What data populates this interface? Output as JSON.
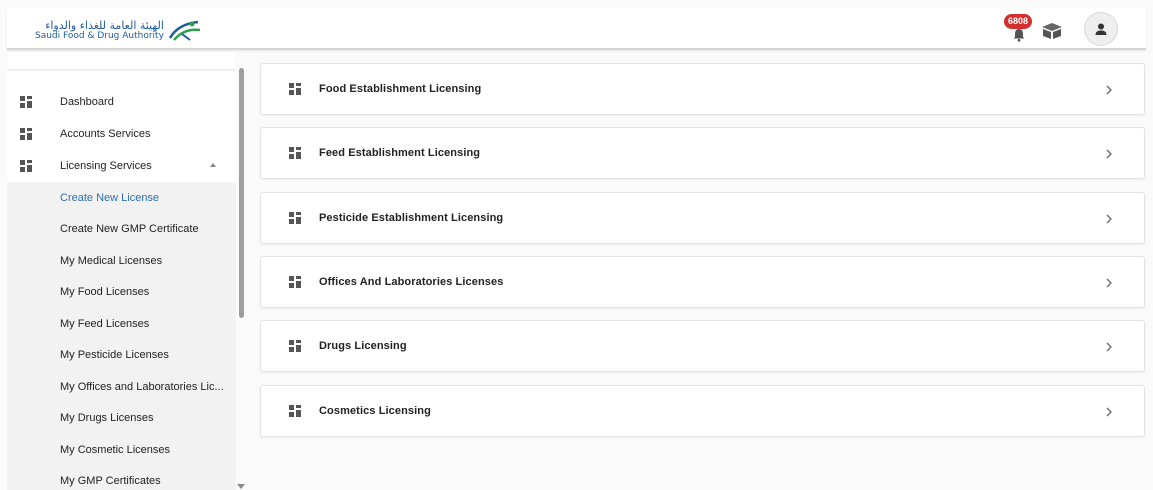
{
  "header": {
    "logo": {
      "arabic": "الهيئة العامة للغذاء والدواء",
      "english": "Saudi Food & Drug Authority"
    },
    "notifications": {
      "count": "6808",
      "icon": "bell-icon"
    },
    "icons": [
      "bell-icon",
      "box-icon",
      "user-icon"
    ]
  },
  "sidebar": {
    "items": [
      {
        "label": "Dashboard",
        "icon": "grid-icon"
      },
      {
        "label": "Accounts Services",
        "icon": "grid-icon"
      },
      {
        "label": "Licensing Services",
        "icon": "grid-icon",
        "expanded": true
      }
    ],
    "sub_items": [
      {
        "label": "Create New License",
        "active": true
      },
      {
        "label": "Create New GMP Certificate"
      },
      {
        "label": "My Medical Licenses"
      },
      {
        "label": "My Food Licenses"
      },
      {
        "label": "My Feed Licenses"
      },
      {
        "label": "My Pesticide Licenses"
      },
      {
        "label": "My Offices and Laboratories Lic..."
      },
      {
        "label": "My Drugs Licenses"
      },
      {
        "label": "My Cosmetic Licenses"
      },
      {
        "label": "My GMP Certificates"
      }
    ]
  },
  "main": {
    "cards": [
      {
        "label": "Food Establishment Licensing"
      },
      {
        "label": "Feed Establishment Licensing"
      },
      {
        "label": "Pesticide Establishment Licensing"
      },
      {
        "label": "Offices And Laboratories Licenses"
      },
      {
        "label": "Drugs Licensing"
      },
      {
        "label": "Cosmetics Licensing"
      }
    ]
  },
  "colors": {
    "active_link": "#2f6fad",
    "badge": "#d32f2f",
    "brand": "#1f5c9e"
  }
}
